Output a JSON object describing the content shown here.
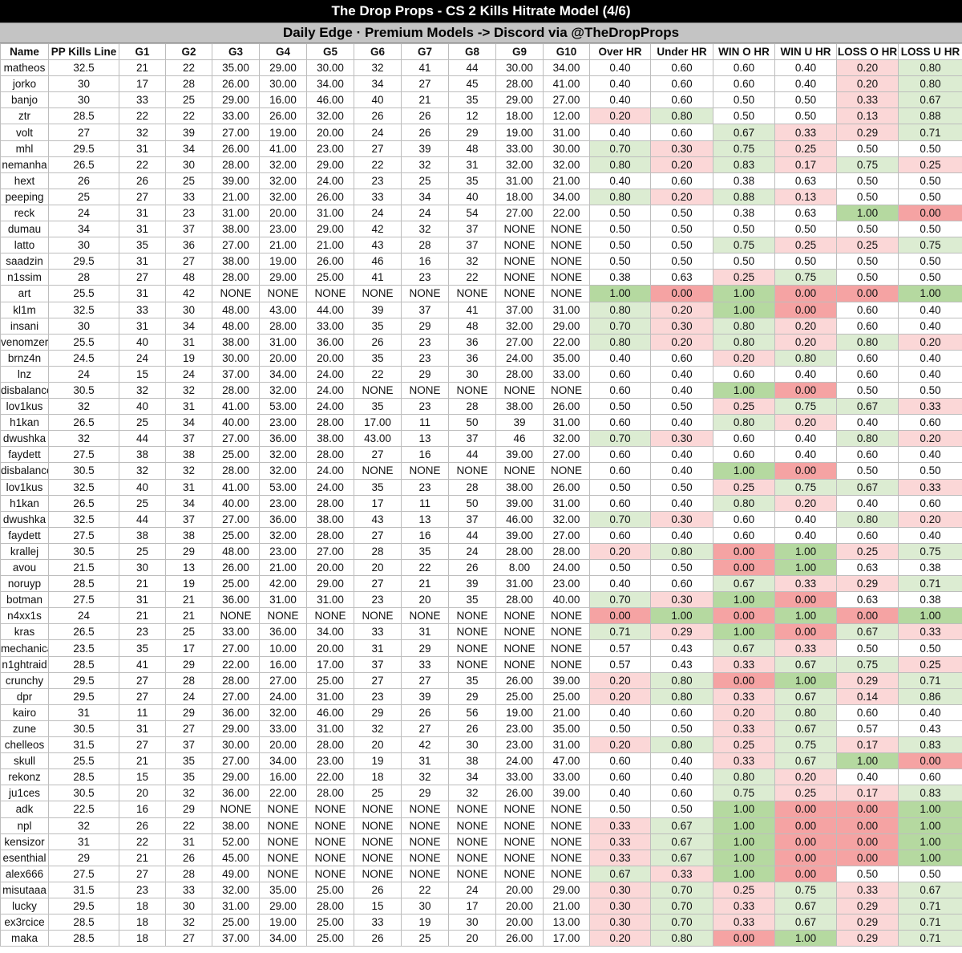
{
  "title": "The Drop Props - CS 2 Kills Hitrate Model (4/6)",
  "subtitle": "Daily Edge · Premium Models -> Discord via @TheDropProps",
  "colors": {
    "green_strong": "#b5d9a0",
    "green_light": "#dcecd2",
    "red_strong": "#f5a3a3",
    "red_light": "#fbd7d7",
    "white": "#ffffff"
  },
  "headers": [
    "Name",
    "PP Kills Line",
    "G1",
    "G2",
    "G3",
    "G4",
    "G5",
    "G6",
    "G7",
    "G8",
    "G9",
    "G10",
    "Over HR",
    "Under HR",
    "WIN O HR",
    "WIN U HR",
    "LOSS O HR",
    "LOSS U HR"
  ],
  "rows": [
    [
      "matheos",
      "32.5",
      "21",
      "22",
      "35.00",
      "29.00",
      "30.00",
      "32",
      "41",
      "44",
      "30.00",
      "34.00",
      "0.40",
      "0.60",
      "0.60",
      "0.40",
      "0.20",
      "0.80"
    ],
    [
      "jorko",
      "30",
      "17",
      "28",
      "26.00",
      "30.00",
      "34.00",
      "34",
      "27",
      "45",
      "28.00",
      "41.00",
      "0.40",
      "0.60",
      "0.60",
      "0.40",
      "0.20",
      "0.80"
    ],
    [
      "banjo",
      "30",
      "33",
      "25",
      "29.00",
      "16.00",
      "46.00",
      "40",
      "21",
      "35",
      "29.00",
      "27.00",
      "0.40",
      "0.60",
      "0.50",
      "0.50",
      "0.33",
      "0.67"
    ],
    [
      "ztr",
      "28.5",
      "22",
      "22",
      "33.00",
      "26.00",
      "32.00",
      "26",
      "26",
      "12",
      "18.00",
      "12.00",
      "0.20",
      "0.80",
      "0.50",
      "0.50",
      "0.13",
      "0.88"
    ],
    [
      "volt",
      "27",
      "32",
      "39",
      "27.00",
      "19.00",
      "20.00",
      "24",
      "26",
      "29",
      "19.00",
      "31.00",
      "0.40",
      "0.60",
      "0.67",
      "0.33",
      "0.29",
      "0.71"
    ],
    [
      "mhl",
      "29.5",
      "31",
      "34",
      "26.00",
      "41.00",
      "23.00",
      "27",
      "39",
      "48",
      "33.00",
      "30.00",
      "0.70",
      "0.30",
      "0.75",
      "0.25",
      "0.50",
      "0.50"
    ],
    [
      "nemanha",
      "26.5",
      "22",
      "30",
      "28.00",
      "32.00",
      "29.00",
      "22",
      "32",
      "31",
      "32.00",
      "32.00",
      "0.80",
      "0.20",
      "0.83",
      "0.17",
      "0.75",
      "0.25"
    ],
    [
      "hext",
      "26",
      "26",
      "25",
      "39.00",
      "32.00",
      "24.00",
      "23",
      "25",
      "35",
      "31.00",
      "21.00",
      "0.40",
      "0.60",
      "0.38",
      "0.63",
      "0.50",
      "0.50"
    ],
    [
      "peeping",
      "25",
      "27",
      "33",
      "21.00",
      "32.00",
      "26.00",
      "33",
      "34",
      "40",
      "18.00",
      "34.00",
      "0.80",
      "0.20",
      "0.88",
      "0.13",
      "0.50",
      "0.50"
    ],
    [
      "reck",
      "24",
      "31",
      "23",
      "31.00",
      "20.00",
      "31.00",
      "24",
      "24",
      "54",
      "27.00",
      "22.00",
      "0.50",
      "0.50",
      "0.38",
      "0.63",
      "1.00",
      "0.00"
    ],
    [
      "dumau",
      "34",
      "31",
      "37",
      "38.00",
      "23.00",
      "29.00",
      "42",
      "32",
      "37",
      "NONE",
      "NONE",
      "0.50",
      "0.50",
      "0.50",
      "0.50",
      "0.50",
      "0.50"
    ],
    [
      "latto",
      "30",
      "35",
      "36",
      "27.00",
      "21.00",
      "21.00",
      "43",
      "28",
      "37",
      "NONE",
      "NONE",
      "0.50",
      "0.50",
      "0.75",
      "0.25",
      "0.25",
      "0.75"
    ],
    [
      "saadzin",
      "29.5",
      "31",
      "27",
      "38.00",
      "19.00",
      "26.00",
      "46",
      "16",
      "32",
      "NONE",
      "NONE",
      "0.50",
      "0.50",
      "0.50",
      "0.50",
      "0.50",
      "0.50"
    ],
    [
      "n1ssim",
      "28",
      "27",
      "48",
      "28.00",
      "29.00",
      "25.00",
      "41",
      "23",
      "22",
      "NONE",
      "NONE",
      "0.38",
      "0.63",
      "0.25",
      "0.75",
      "0.50",
      "0.50"
    ],
    [
      "art",
      "25.5",
      "31",
      "42",
      "NONE",
      "NONE",
      "NONE",
      "NONE",
      "NONE",
      "NONE",
      "NONE",
      "NONE",
      "1.00",
      "0.00",
      "1.00",
      "0.00",
      "0.00",
      "1.00"
    ],
    [
      "kl1m",
      "32.5",
      "33",
      "30",
      "48.00",
      "43.00",
      "44.00",
      "39",
      "37",
      "41",
      "37.00",
      "31.00",
      "0.80",
      "0.20",
      "1.00",
      "0.00",
      "0.60",
      "0.40"
    ],
    [
      "insani",
      "30",
      "31",
      "34",
      "48.00",
      "28.00",
      "33.00",
      "35",
      "29",
      "48",
      "32.00",
      "29.00",
      "0.70",
      "0.30",
      "0.80",
      "0.20",
      "0.60",
      "0.40"
    ],
    [
      "venomzera",
      "25.5",
      "40",
      "31",
      "38.00",
      "31.00",
      "36.00",
      "26",
      "23",
      "36",
      "27.00",
      "22.00",
      "0.80",
      "0.20",
      "0.80",
      "0.20",
      "0.80",
      "0.20"
    ],
    [
      "brnz4n",
      "24.5",
      "24",
      "19",
      "30.00",
      "20.00",
      "20.00",
      "35",
      "23",
      "36",
      "24.00",
      "35.00",
      "0.40",
      "0.60",
      "0.20",
      "0.80",
      "0.60",
      "0.40"
    ],
    [
      "lnz",
      "24",
      "15",
      "24",
      "37.00",
      "34.00",
      "24.00",
      "22",
      "29",
      "30",
      "28.00",
      "33.00",
      "0.60",
      "0.40",
      "0.60",
      "0.40",
      "0.60",
      "0.40"
    ],
    [
      "disbalance",
      "30.5",
      "32",
      "32",
      "28.00",
      "32.00",
      "24.00",
      "NONE",
      "NONE",
      "NONE",
      "NONE",
      "NONE",
      "0.60",
      "0.40",
      "1.00",
      "0.00",
      "0.50",
      "0.50"
    ],
    [
      "lov1kus",
      "32",
      "40",
      "31",
      "41.00",
      "53.00",
      "24.00",
      "35",
      "23",
      "28",
      "38.00",
      "26.00",
      "0.50",
      "0.50",
      "0.25",
      "0.75",
      "0.67",
      "0.33"
    ],
    [
      "h1kan",
      "26.5",
      "25",
      "34",
      "40.00",
      "23.00",
      "28.00",
      "17.00",
      "11",
      "50",
      "39",
      "31.00",
      "0.60",
      "0.40",
      "0.80",
      "0.20",
      "0.40",
      "0.60"
    ],
    [
      "dwushka",
      "32",
      "44",
      "37",
      "27.00",
      "36.00",
      "38.00",
      "43.00",
      "13",
      "37",
      "46",
      "32.00",
      "0.70",
      "0.30",
      "0.60",
      "0.40",
      "0.80",
      "0.20"
    ],
    [
      "faydett",
      "27.5",
      "38",
      "38",
      "25.00",
      "32.00",
      "28.00",
      "27",
      "16",
      "44",
      "39.00",
      "27.00",
      "0.60",
      "0.40",
      "0.60",
      "0.40",
      "0.60",
      "0.40"
    ],
    [
      "disbalance",
      "30.5",
      "32",
      "32",
      "28.00",
      "32.00",
      "24.00",
      "NONE",
      "NONE",
      "NONE",
      "NONE",
      "NONE",
      "0.60",
      "0.40",
      "1.00",
      "0.00",
      "0.50",
      "0.50"
    ],
    [
      "lov1kus",
      "32.5",
      "40",
      "31",
      "41.00",
      "53.00",
      "24.00",
      "35",
      "23",
      "28",
      "38.00",
      "26.00",
      "0.50",
      "0.50",
      "0.25",
      "0.75",
      "0.67",
      "0.33"
    ],
    [
      "h1kan",
      "26.5",
      "25",
      "34",
      "40.00",
      "23.00",
      "28.00",
      "17",
      "11",
      "50",
      "39.00",
      "31.00",
      "0.60",
      "0.40",
      "0.80",
      "0.20",
      "0.40",
      "0.60"
    ],
    [
      "dwushka",
      "32.5",
      "44",
      "37",
      "27.00",
      "36.00",
      "38.00",
      "43",
      "13",
      "37",
      "46.00",
      "32.00",
      "0.70",
      "0.30",
      "0.60",
      "0.40",
      "0.80",
      "0.20"
    ],
    [
      "faydett",
      "27.5",
      "38",
      "38",
      "25.00",
      "32.00",
      "28.00",
      "27",
      "16",
      "44",
      "39.00",
      "27.00",
      "0.60",
      "0.40",
      "0.60",
      "0.40",
      "0.60",
      "0.40"
    ],
    [
      "krallej",
      "30.5",
      "25",
      "29",
      "48.00",
      "23.00",
      "27.00",
      "28",
      "35",
      "24",
      "28.00",
      "28.00",
      "0.20",
      "0.80",
      "0.00",
      "1.00",
      "0.25",
      "0.75"
    ],
    [
      "avou",
      "21.5",
      "30",
      "13",
      "26.00",
      "21.00",
      "20.00",
      "20",
      "22",
      "26",
      "8.00",
      "24.00",
      "0.50",
      "0.50",
      "0.00",
      "1.00",
      "0.63",
      "0.38"
    ],
    [
      "noruyp",
      "28.5",
      "21",
      "19",
      "25.00",
      "42.00",
      "29.00",
      "27",
      "21",
      "39",
      "31.00",
      "23.00",
      "0.40",
      "0.60",
      "0.67",
      "0.33",
      "0.29",
      "0.71"
    ],
    [
      "botman",
      "27.5",
      "31",
      "21",
      "36.00",
      "31.00",
      "31.00",
      "23",
      "20",
      "35",
      "28.00",
      "40.00",
      "0.70",
      "0.30",
      "1.00",
      "0.00",
      "0.63",
      "0.38"
    ],
    [
      "n4xx1s",
      "24",
      "21",
      "21",
      "NONE",
      "NONE",
      "NONE",
      "NONE",
      "NONE",
      "NONE",
      "NONE",
      "NONE",
      "0.00",
      "1.00",
      "0.00",
      "1.00",
      "0.00",
      "1.00"
    ],
    [
      "kras",
      "26.5",
      "23",
      "25",
      "33.00",
      "36.00",
      "34.00",
      "33",
      "31",
      "NONE",
      "NONE",
      "NONE",
      "0.71",
      "0.29",
      "1.00",
      "0.00",
      "0.67",
      "0.33"
    ],
    [
      "mechanical",
      "23.5",
      "35",
      "17",
      "27.00",
      "10.00",
      "20.00",
      "31",
      "29",
      "NONE",
      "NONE",
      "NONE",
      "0.57",
      "0.43",
      "0.67",
      "0.33",
      "0.50",
      "0.50"
    ],
    [
      "n1ghtraid",
      "28.5",
      "41",
      "29",
      "22.00",
      "16.00",
      "17.00",
      "37",
      "33",
      "NONE",
      "NONE",
      "NONE",
      "0.57",
      "0.43",
      "0.33",
      "0.67",
      "0.75",
      "0.25"
    ],
    [
      "crunchy",
      "29.5",
      "27",
      "28",
      "28.00",
      "27.00",
      "25.00",
      "27",
      "27",
      "35",
      "26.00",
      "39.00",
      "0.20",
      "0.80",
      "0.00",
      "1.00",
      "0.29",
      "0.71"
    ],
    [
      "dpr",
      "29.5",
      "27",
      "24",
      "27.00",
      "24.00",
      "31.00",
      "23",
      "39",
      "29",
      "25.00",
      "25.00",
      "0.20",
      "0.80",
      "0.33",
      "0.67",
      "0.14",
      "0.86"
    ],
    [
      "kairo",
      "31",
      "11",
      "29",
      "36.00",
      "32.00",
      "46.00",
      "29",
      "26",
      "56",
      "19.00",
      "21.00",
      "0.40",
      "0.60",
      "0.20",
      "0.80",
      "0.60",
      "0.40"
    ],
    [
      "zune",
      "30.5",
      "31",
      "27",
      "29.00",
      "33.00",
      "31.00",
      "32",
      "27",
      "26",
      "23.00",
      "35.00",
      "0.50",
      "0.50",
      "0.33",
      "0.67",
      "0.57",
      "0.43"
    ],
    [
      "chelleos",
      "31.5",
      "27",
      "37",
      "30.00",
      "20.00",
      "28.00",
      "20",
      "42",
      "30",
      "23.00",
      "31.00",
      "0.20",
      "0.80",
      "0.25",
      "0.75",
      "0.17",
      "0.83"
    ],
    [
      "skull",
      "25.5",
      "21",
      "35",
      "27.00",
      "34.00",
      "23.00",
      "19",
      "31",
      "38",
      "24.00",
      "47.00",
      "0.60",
      "0.40",
      "0.33",
      "0.67",
      "1.00",
      "0.00"
    ],
    [
      "rekonz",
      "28.5",
      "15",
      "35",
      "29.00",
      "16.00",
      "22.00",
      "18",
      "32",
      "34",
      "33.00",
      "33.00",
      "0.60",
      "0.40",
      "0.80",
      "0.20",
      "0.40",
      "0.60"
    ],
    [
      "ju1ces",
      "30.5",
      "20",
      "32",
      "36.00",
      "22.00",
      "28.00",
      "25",
      "29",
      "32",
      "26.00",
      "39.00",
      "0.40",
      "0.60",
      "0.75",
      "0.25",
      "0.17",
      "0.83"
    ],
    [
      "adk",
      "22.5",
      "16",
      "29",
      "NONE",
      "NONE",
      "NONE",
      "NONE",
      "NONE",
      "NONE",
      "NONE",
      "NONE",
      "0.50",
      "0.50",
      "1.00",
      "0.00",
      "0.00",
      "1.00"
    ],
    [
      "npl",
      "32",
      "26",
      "22",
      "38.00",
      "NONE",
      "NONE",
      "NONE",
      "NONE",
      "NONE",
      "NONE",
      "NONE",
      "0.33",
      "0.67",
      "1.00",
      "0.00",
      "0.00",
      "1.00"
    ],
    [
      "kensizor",
      "31",
      "22",
      "31",
      "52.00",
      "NONE",
      "NONE",
      "NONE",
      "NONE",
      "NONE",
      "NONE",
      "NONE",
      "0.33",
      "0.67",
      "1.00",
      "0.00",
      "0.00",
      "1.00"
    ],
    [
      "esenthial",
      "29",
      "21",
      "26",
      "45.00",
      "NONE",
      "NONE",
      "NONE",
      "NONE",
      "NONE",
      "NONE",
      "NONE",
      "0.33",
      "0.67",
      "1.00",
      "0.00",
      "0.00",
      "1.00"
    ],
    [
      "alex666",
      "27.5",
      "27",
      "28",
      "49.00",
      "NONE",
      "NONE",
      "NONE",
      "NONE",
      "NONE",
      "NONE",
      "NONE",
      "0.67",
      "0.33",
      "1.00",
      "0.00",
      "0.50",
      "0.50"
    ],
    [
      "misutaaa",
      "31.5",
      "23",
      "33",
      "32.00",
      "35.00",
      "25.00",
      "26",
      "22",
      "24",
      "20.00",
      "29.00",
      "0.30",
      "0.70",
      "0.25",
      "0.75",
      "0.33",
      "0.67"
    ],
    [
      "lucky",
      "29.5",
      "18",
      "30",
      "31.00",
      "29.00",
      "28.00",
      "15",
      "30",
      "17",
      "20.00",
      "21.00",
      "0.30",
      "0.70",
      "0.33",
      "0.67",
      "0.29",
      "0.71"
    ],
    [
      "ex3rcice",
      "28.5",
      "18",
      "32",
      "25.00",
      "19.00",
      "25.00",
      "33",
      "19",
      "30",
      "20.00",
      "13.00",
      "0.30",
      "0.70",
      "0.33",
      "0.67",
      "0.29",
      "0.71"
    ],
    [
      "maka",
      "28.5",
      "18",
      "27",
      "37.00",
      "34.00",
      "25.00",
      "26",
      "25",
      "20",
      "26.00",
      "17.00",
      "0.20",
      "0.80",
      "0.00",
      "1.00",
      "0.29",
      "0.71"
    ]
  ]
}
